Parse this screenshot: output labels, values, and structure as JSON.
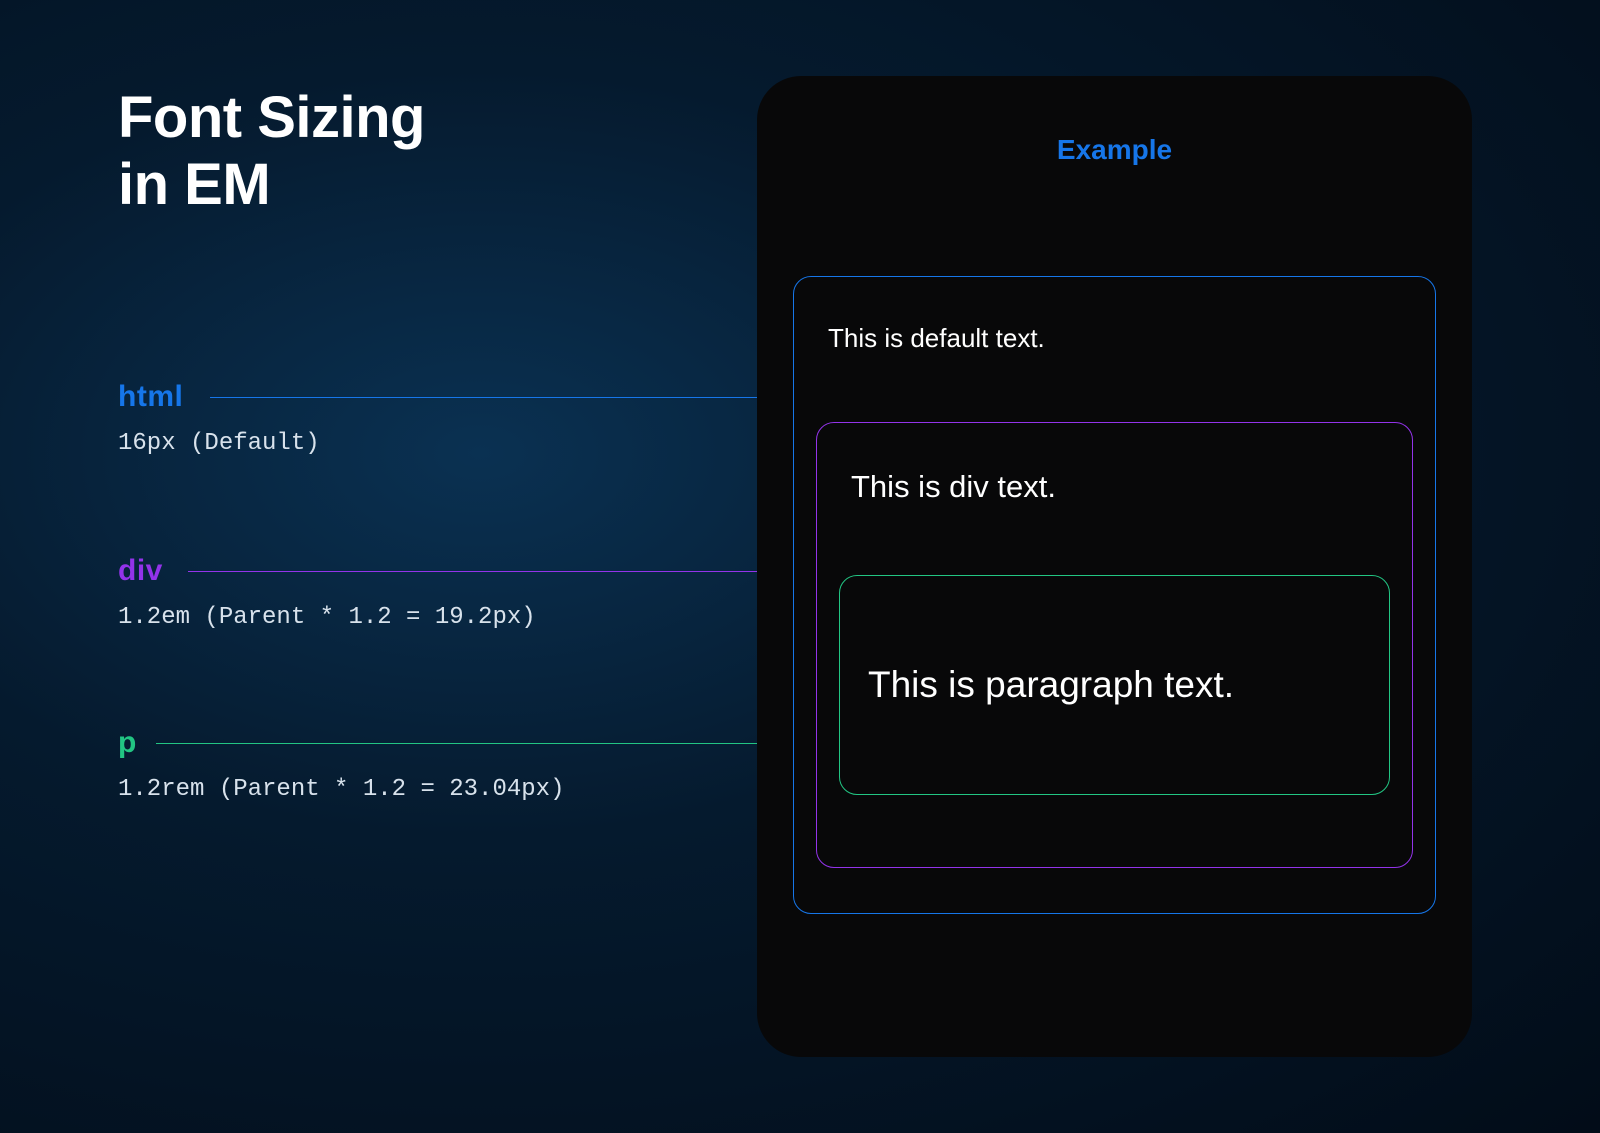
{
  "title_line1": "Font Sizing",
  "title_line2": "in EM",
  "legend": {
    "html": {
      "tag": "html",
      "desc": "16px (Default)"
    },
    "div": {
      "tag": "div",
      "desc": "1.2em (Parent * 1.2 = 19.2px)"
    },
    "p": {
      "tag": "p",
      "desc": "1.2rem (Parent * 1.2 = 23.04px)"
    }
  },
  "example": {
    "heading": "Example",
    "html_text": "This is default text.",
    "div_text": "This is div text.",
    "p_text": "This is paragraph text."
  },
  "colors": {
    "html": "#1676e9",
    "div": "#9333ea",
    "p": "#22c583"
  }
}
